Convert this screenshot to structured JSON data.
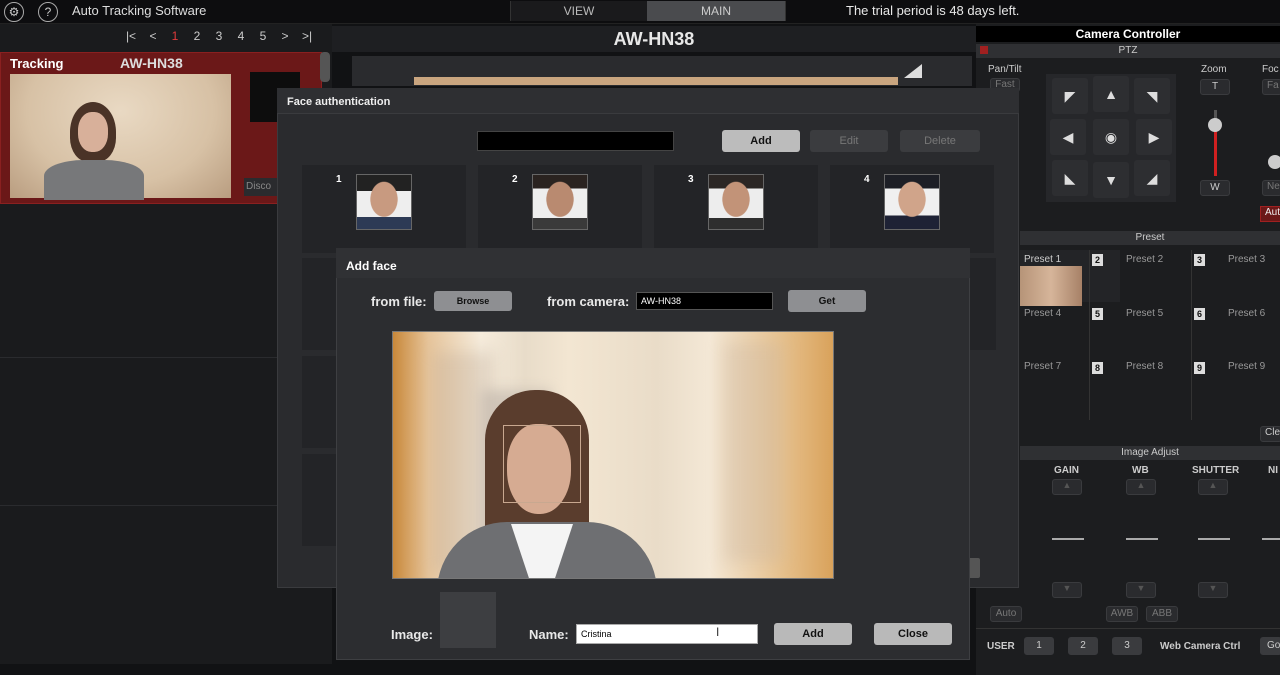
{
  "app": {
    "title": "Auto Tracking Software",
    "settings_icon": "gear-icon",
    "help_icon": "question-icon",
    "help_glyph": "?"
  },
  "tabs": [
    {
      "label": "VIEW"
    },
    {
      "label": "MAIN"
    }
  ],
  "trial_text": "The trial period is 48 days left.",
  "pager": {
    "first": "|<",
    "prev": "<",
    "pages": [
      "1",
      "2",
      "3",
      "4",
      "5"
    ],
    "next": ">",
    "last": ">|",
    "active": "1"
  },
  "tracking": {
    "label": "Tracking",
    "camera": "AW-HN38",
    "disconnect": "Disco"
  },
  "center": {
    "title": "AW-HN38"
  },
  "camera_controller": {
    "title": "Camera Controller",
    "ptz": "PTZ",
    "pan_tilt": "Pan/Tilt",
    "fast": "Fast",
    "zoom": "Zoom",
    "zoom_t": "T",
    "zoom_w": "W",
    "focus": "Foc",
    "focus_far": "Fa",
    "focus_near": "Ne",
    "auto": "Aut",
    "preset_title": "Preset",
    "presets": [
      {
        "num": "1",
        "label": "Preset 1"
      },
      {
        "num": "2",
        "label": "Preset 2"
      },
      {
        "num": "3",
        "label": "Preset 3"
      },
      {
        "num": "4",
        "label": "Preset 4"
      },
      {
        "num": "5",
        "label": "Preset 5"
      },
      {
        "num": "6",
        "label": "Preset 6"
      },
      {
        "num": "7",
        "label": "Preset 7"
      },
      {
        "num": "8",
        "label": "Preset 8"
      },
      {
        "num": "9",
        "label": "Preset 9"
      }
    ],
    "clear": "Cle",
    "image_adjust": "Image Adjust",
    "gain": "GAIN",
    "wb": "WB",
    "shutter": "SHUTTER",
    "nd": "NI",
    "auto_btn": "Auto",
    "awb": "AWB",
    "abb": "ABB",
    "user": "USER",
    "user_buttons": [
      "1",
      "2",
      "3"
    ],
    "web_camera": "Web Camera Ctrl",
    "go": "Go"
  },
  "face_auth": {
    "title": "Face authentication",
    "add": "Add",
    "edit": "Edit",
    "delete": "Delete",
    "faces": [
      {
        "num": "1"
      },
      {
        "num": "2"
      },
      {
        "num": "3"
      },
      {
        "num": "4"
      }
    ]
  },
  "add_face": {
    "title": "Add face",
    "from_file": "from file:",
    "browse": "Browse",
    "from_camera": "from camera:",
    "camera_value": "AW-HN38",
    "get": "Get",
    "image_label": "Image:",
    "name_label": "Name:",
    "name_value": "Cristina",
    "add": "Add",
    "close": "Close"
  },
  "colors": {
    "accent_red": "#8a2020",
    "background": "#111214",
    "dialog": "#2a2b2e"
  }
}
